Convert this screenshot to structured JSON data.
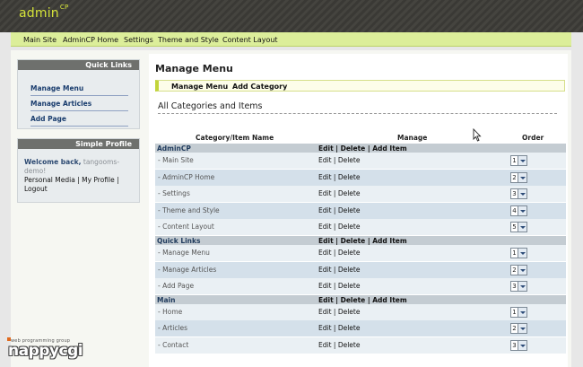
{
  "header": {
    "logo_text": "admin",
    "logo_sup": "CP"
  },
  "topnav": {
    "items": [
      "Main Site",
      "AdminCP Home",
      "Settings",
      "Theme and Style",
      "Content Layout"
    ]
  },
  "quick_links": {
    "title": "Quick Links",
    "items": [
      "Manage Menu",
      "Manage Articles",
      "Add Page"
    ]
  },
  "profile": {
    "title": "Simple Profile",
    "welcome": "Welcome back,",
    "username": "tangooms-demo!",
    "links": [
      "Personal Media",
      "My Profile",
      "Logout"
    ],
    "separator": "|"
  },
  "main": {
    "title": "Manage Menu",
    "subnav": [
      "Manage Menu",
      "Add Category"
    ],
    "section_title": "All Categories and Items",
    "columns": {
      "name": "Category/Item Name",
      "manage": "Manage",
      "order": "Order"
    }
  },
  "table": {
    "cat_actions": {
      "edit": "Edit",
      "delete": "Delete",
      "add": "Add Item"
    },
    "item_actions": {
      "edit": "Edit",
      "delete": "Delete"
    },
    "rows": [
      {
        "type": "cat",
        "name": "AdminCP"
      },
      {
        "type": "item",
        "name": "- Main Site",
        "order": "1"
      },
      {
        "type": "item",
        "name": "- AdminCP Home",
        "order": "2"
      },
      {
        "type": "item",
        "name": "- Settings",
        "order": "3"
      },
      {
        "type": "item",
        "name": "- Theme and Style",
        "order": "4"
      },
      {
        "type": "item",
        "name": "- Content Layout",
        "order": "5"
      },
      {
        "type": "cat",
        "name": "Quick Links"
      },
      {
        "type": "item",
        "name": "- Manage Menu",
        "order": "1"
      },
      {
        "type": "item",
        "name": "- Manage Articles",
        "order": "2"
      },
      {
        "type": "item",
        "name": "- Add Page",
        "order": "3"
      },
      {
        "type": "cat",
        "name": "Main"
      },
      {
        "type": "item",
        "name": "- Home",
        "order": "1"
      },
      {
        "type": "item",
        "name": "- Articles",
        "order": "2"
      },
      {
        "type": "item",
        "name": "- Contact",
        "order": "3"
      }
    ]
  },
  "watermark": {
    "small": "web programming group",
    "big": "nappycgi"
  },
  "colors": {
    "accent": "#d6e43a",
    "nav_bg": "#dcee9a",
    "cat_row": "#c4ccd2",
    "header": "#3a3935"
  }
}
